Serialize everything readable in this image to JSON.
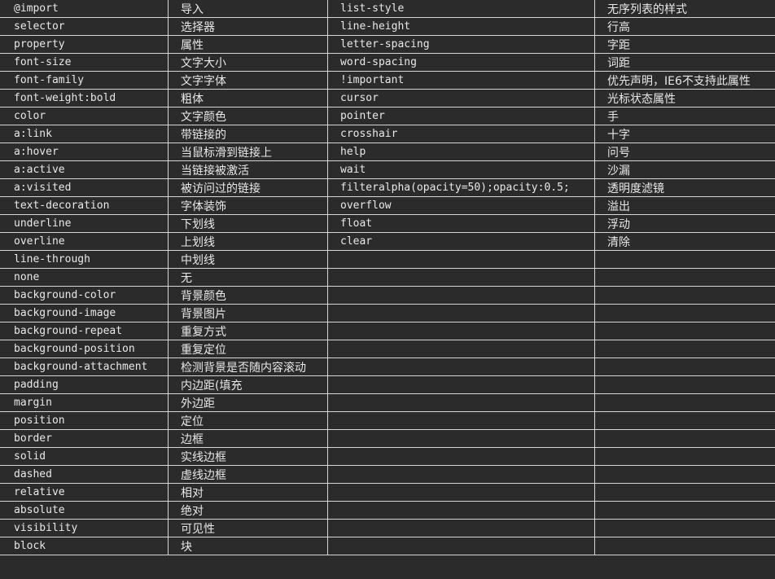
{
  "rows": [
    {
      "prop": "@import",
      "desc": "导入",
      "prop2": "list-style",
      "desc2": "无序列表的样式"
    },
    {
      "prop": "selector",
      "desc": "选择器",
      "prop2": "line-height",
      "desc2": "行高"
    },
    {
      "prop": "property",
      "desc": "属性",
      "prop2": "letter-spacing",
      "desc2": "字距"
    },
    {
      "prop": "font-size",
      "desc": "文字大小",
      "prop2": "word-spacing",
      "desc2": "词距"
    },
    {
      "prop": "font-family",
      "desc": "文字字体",
      "prop2": "!important",
      "desc2": "优先声明，IE6不支持此属性"
    },
    {
      "prop": "font-weight:bold",
      "desc": "粗体",
      "prop2": "cursor",
      "desc2": "光标状态属性"
    },
    {
      "prop": "color",
      "desc": "文字颜色",
      "prop2": "pointer",
      "desc2": "手"
    },
    {
      "prop": "a:link",
      "desc": "带链接的",
      "prop2": "crosshair",
      "desc2": "十字"
    },
    {
      "prop": "a:hover",
      "desc": "当鼠标滑到链接上",
      "prop2": "help",
      "desc2": "问号"
    },
    {
      "prop": "a:active",
      "desc": "当链接被激活",
      "prop2": "wait",
      "desc2": "沙漏"
    },
    {
      "prop": "a:visited",
      "desc": "被访问过的链接",
      "prop2": "filteralpha(opacity=50);opacity:0.5;",
      "desc2": "透明度滤镜"
    },
    {
      "prop": "text-decoration",
      "desc": "字体装饰",
      "prop2": "overflow",
      "desc2": "溢出"
    },
    {
      "prop": "underline",
      "desc": "下划线",
      "prop2": "float",
      "desc2": "浮动"
    },
    {
      "prop": "overline",
      "desc": "上划线",
      "prop2": "clear",
      "desc2": "清除"
    },
    {
      "prop": "line-through",
      "desc": "中划线",
      "prop2": "",
      "desc2": ""
    },
    {
      "prop": "none",
      "desc": "无",
      "prop2": "",
      "desc2": ""
    },
    {
      "prop": "background-color",
      "desc": "背景颜色",
      "prop2": "",
      "desc2": ""
    },
    {
      "prop": "background-image",
      "desc": "背景图片",
      "prop2": "",
      "desc2": ""
    },
    {
      "prop": "background-repeat",
      "desc": "重复方式",
      "prop2": "",
      "desc2": ""
    },
    {
      "prop": "background-position",
      "desc": "重复定位",
      "prop2": "",
      "desc2": ""
    },
    {
      "prop": "background-attachment",
      "desc": "检测背景是否随内容滚动",
      "prop2": "",
      "desc2": ""
    },
    {
      "prop": "padding",
      "desc": "内边距(填充",
      "prop2": "",
      "desc2": ""
    },
    {
      "prop": "margin",
      "desc": "外边距",
      "prop2": "",
      "desc2": ""
    },
    {
      "prop": "position",
      "desc": "定位",
      "prop2": "",
      "desc2": ""
    },
    {
      "prop": "border",
      "desc": "边框",
      "prop2": "",
      "desc2": ""
    },
    {
      "prop": "solid",
      "desc": "实线边框",
      "prop2": "",
      "desc2": ""
    },
    {
      "prop": "dashed",
      "desc": "虚线边框",
      "prop2": "",
      "desc2": ""
    },
    {
      "prop": "relative",
      "desc": "相对",
      "prop2": "",
      "desc2": ""
    },
    {
      "prop": "absolute",
      "desc": "绝对",
      "prop2": "",
      "desc2": ""
    },
    {
      "prop": "visibility",
      "desc": "可见性",
      "prop2": "",
      "desc2": ""
    },
    {
      "prop": "block",
      "desc": "块",
      "prop2": "",
      "desc2": ""
    }
  ]
}
